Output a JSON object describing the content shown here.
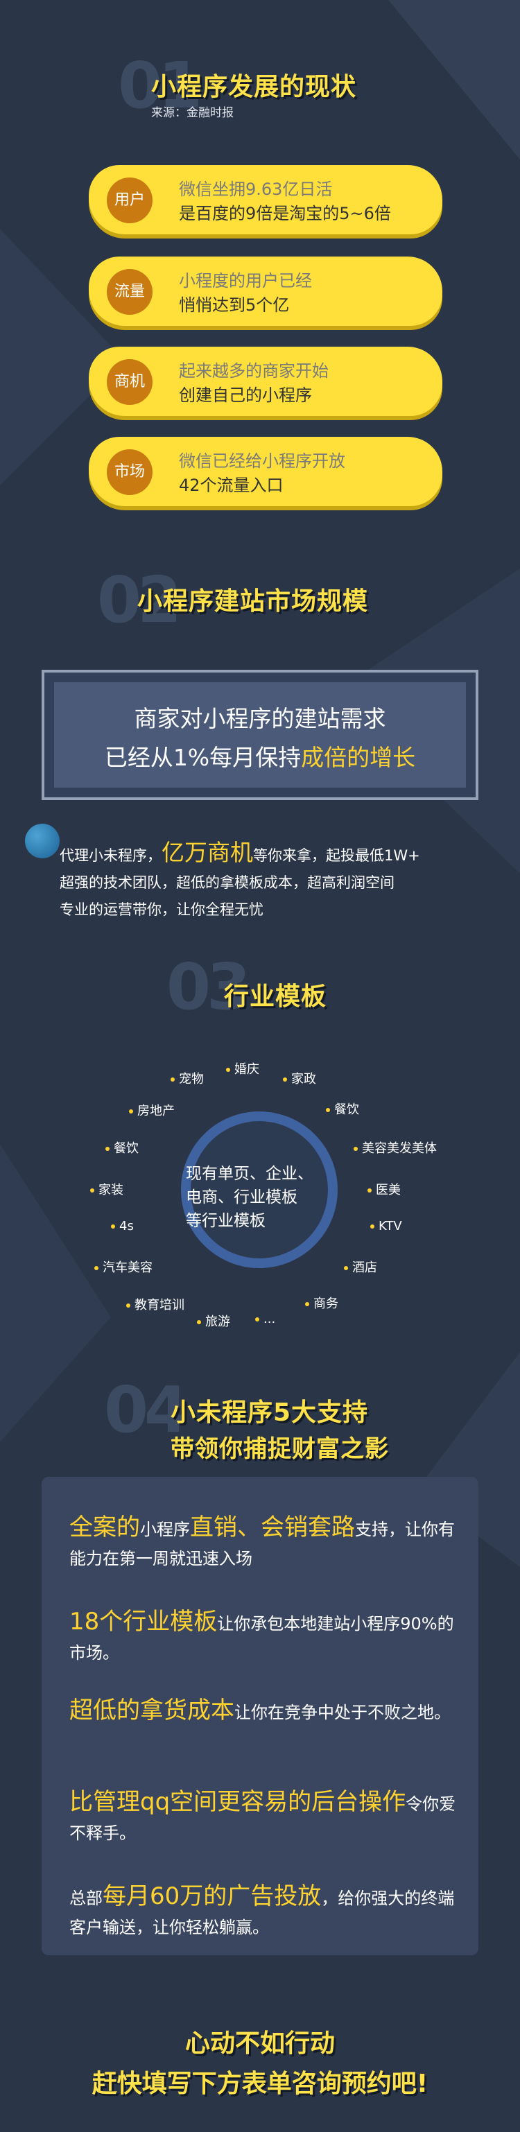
{
  "section1": {
    "num": "01",
    "title": "小程序发展的现状",
    "source": "来源：金融时报",
    "items": [
      {
        "badge": "用户",
        "line1": "微信坐拥9.63亿日活",
        "line2": "是百度的9倍是淘宝的5~6倍"
      },
      {
        "badge": "流量",
        "line1": "小程度的用户已经",
        "line2": "悄悄达到5个亿"
      },
      {
        "badge": "商机",
        "line1": "起来越多的商家开始",
        "line2": "创建自己的小程序"
      },
      {
        "badge": "市场",
        "line1": "微信已经给小程序开放",
        "line2": "42个流量入口"
      }
    ]
  },
  "section2": {
    "num": "02",
    "title": "小程序建站市场规模",
    "box_line1": "商家对小程序的建站需求",
    "box_line2_prefix": "已经从1%每月保持",
    "box_line2_highlight": "成倍的增长",
    "para_prefix": "代理小未程序，",
    "para_big": "亿万商机",
    "para_rest1": "等你来拿，起投最低1W+",
    "para_line2": "超强的技术团队，超低的拿模板成本，超高利润空间",
    "para_line3": "专业的运营带你，让你全程无忧"
  },
  "section3": {
    "num": "03",
    "title": "行业模板",
    "center_line1": "现有单页、企业、",
    "center_line2": "电商、行业模板",
    "center_line3": "等行业模板",
    "tags": [
      "宠物",
      "婚庆",
      "家政",
      "房地产",
      "餐饮",
      "餐饮",
      "美容美发美体",
      "家装",
      "医美",
      "4s",
      "KTV",
      "汽车美容",
      "酒店",
      "教育培训",
      "商务",
      "旅游",
      "..."
    ]
  },
  "section4": {
    "num": "04",
    "title_line1": "小未程序5大支持",
    "title_line2": "带领你捕捉财富之影",
    "items": [
      {
        "pre": "",
        "hl": "全案的",
        "mid": "小程序",
        "hl2": "直销、会销套路",
        "post": "支持，让你有能力在第一周就迅速入场"
      },
      {
        "pre": "",
        "hl": "18个行业模板",
        "mid": "让你承包本地建站小程序90%的市场。",
        "hl2": "",
        "post": ""
      },
      {
        "pre": "",
        "hl": "超低的拿货成本",
        "mid": "让你在竞争中处于不败之地。",
        "hl2": "",
        "post": ""
      },
      {
        "pre": "",
        "hl": "比管理qq空间更容易的后台操作",
        "mid": "令你爱不释手。",
        "hl2": "",
        "post": ""
      },
      {
        "pre": "总部",
        "hl": "每月60万的广告投放",
        "mid": "，给你强大的终端客户输送，让你轻松躺赢。",
        "hl2": "",
        "post": ""
      }
    ]
  },
  "footer": {
    "line1": "心动不如行动",
    "line2": "赶快填写下方表单咨询预约吧!"
  }
}
